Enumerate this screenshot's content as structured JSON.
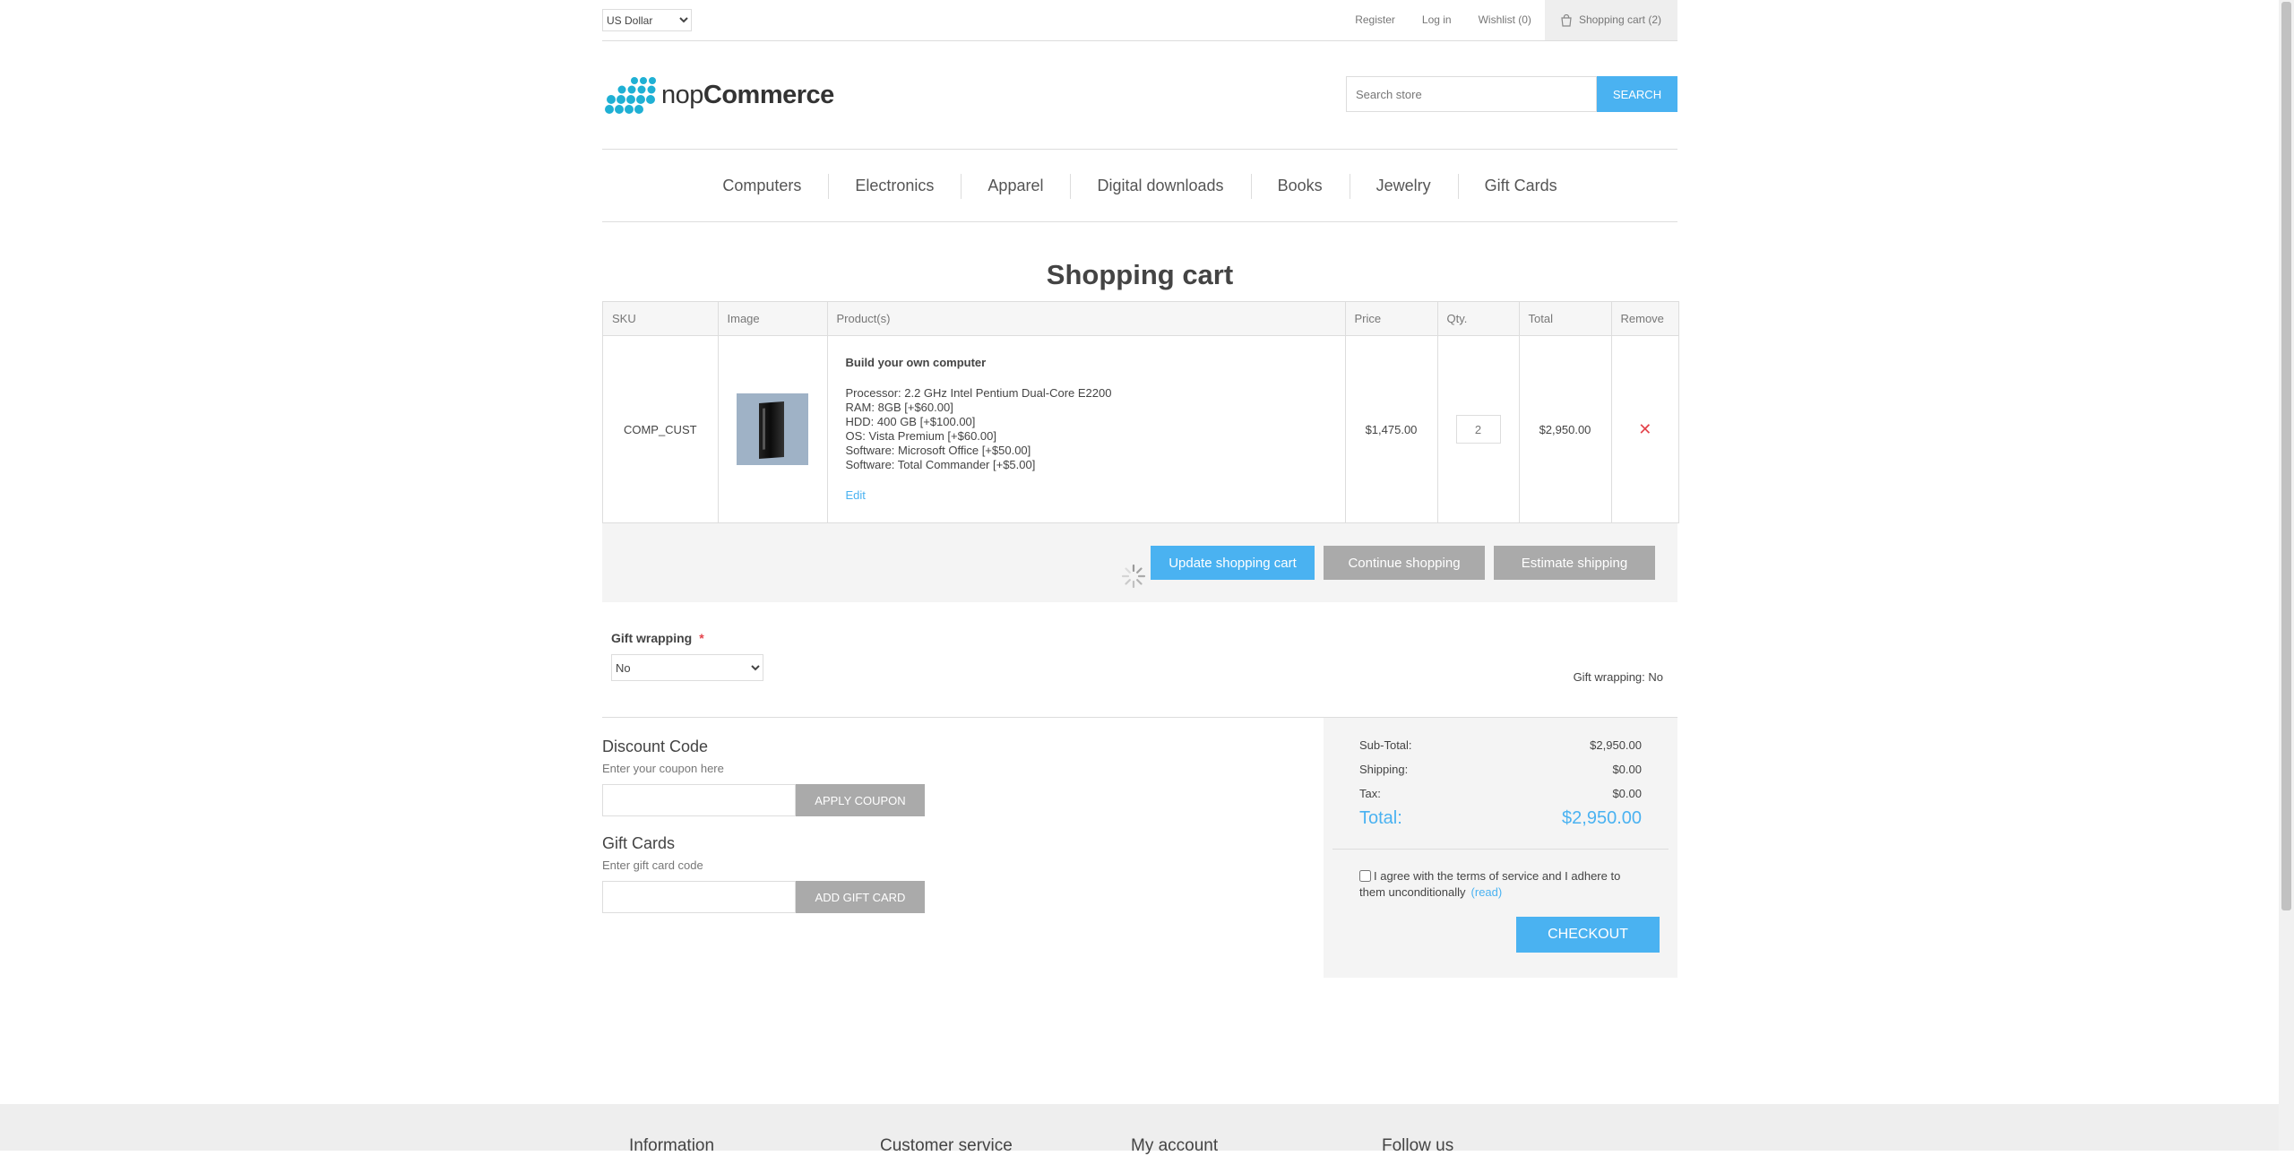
{
  "header": {
    "currency": "US Dollar",
    "links": {
      "register": "Register",
      "login": "Log in",
      "wishlist": "Wishlist (0)",
      "cart": "Shopping cart (2)"
    },
    "logo": {
      "light": "nop",
      "bold": "Commerce"
    },
    "search": {
      "placeholder": "Search store",
      "button": "Search"
    }
  },
  "menu": [
    "Computers",
    "Electronics",
    "Apparel",
    "Digital downloads",
    "Books",
    "Jewelry",
    "Gift Cards"
  ],
  "page_title": "Shopping cart",
  "cart": {
    "columns": [
      "SKU",
      "Image",
      "Product(s)",
      "Price",
      "Qty.",
      "Total",
      "Remove"
    ],
    "items": [
      {
        "sku": "COMP_CUST",
        "name": "Build your own computer",
        "attributes": [
          "Processor: 2.2 GHz Intel Pentium Dual-Core E2200",
          "RAM: 8GB [+$60.00]",
          "HDD: 400 GB [+$100.00]",
          "OS: Vista Premium [+$60.00]",
          "Software: Microsoft Office [+$50.00]",
          "Software: Total Commander [+$5.00]"
        ],
        "edit": "Edit",
        "price": "$1,475.00",
        "qty": "2",
        "total": "$2,950.00",
        "remove_icon": "close-icon"
      }
    ],
    "buttons": {
      "update": "Update shopping cart",
      "continue": "Continue shopping",
      "estimate": "Estimate shipping"
    }
  },
  "gift_wrapping": {
    "label": "Gift wrapping",
    "required": "*",
    "value": "No",
    "info": "Gift wrapping: No"
  },
  "discount": {
    "title": "Discount Code",
    "hint": "Enter your coupon here",
    "button": "Apply coupon"
  },
  "gift_cards": {
    "title": "Gift Cards",
    "hint": "Enter gift card code",
    "button": "Add gift card"
  },
  "totals": {
    "subtotal_label": "Sub-Total:",
    "subtotal": "$2,950.00",
    "shipping_label": "Shipping:",
    "shipping": "$0.00",
    "tax_label": "Tax:",
    "tax": "$0.00",
    "total_label": "Total:",
    "total": "$2,950.00",
    "terms": "I agree with the terms of service and I adhere to them unconditionally",
    "read": "(read)",
    "checkout": "Checkout"
  },
  "footer": {
    "columns": [
      "Information",
      "Customer service",
      "My account",
      "Follow us"
    ]
  },
  "colors": {
    "accent": "#4ab2f1",
    "grey_button": "#aaaaaa",
    "remove": "#e4434b"
  }
}
